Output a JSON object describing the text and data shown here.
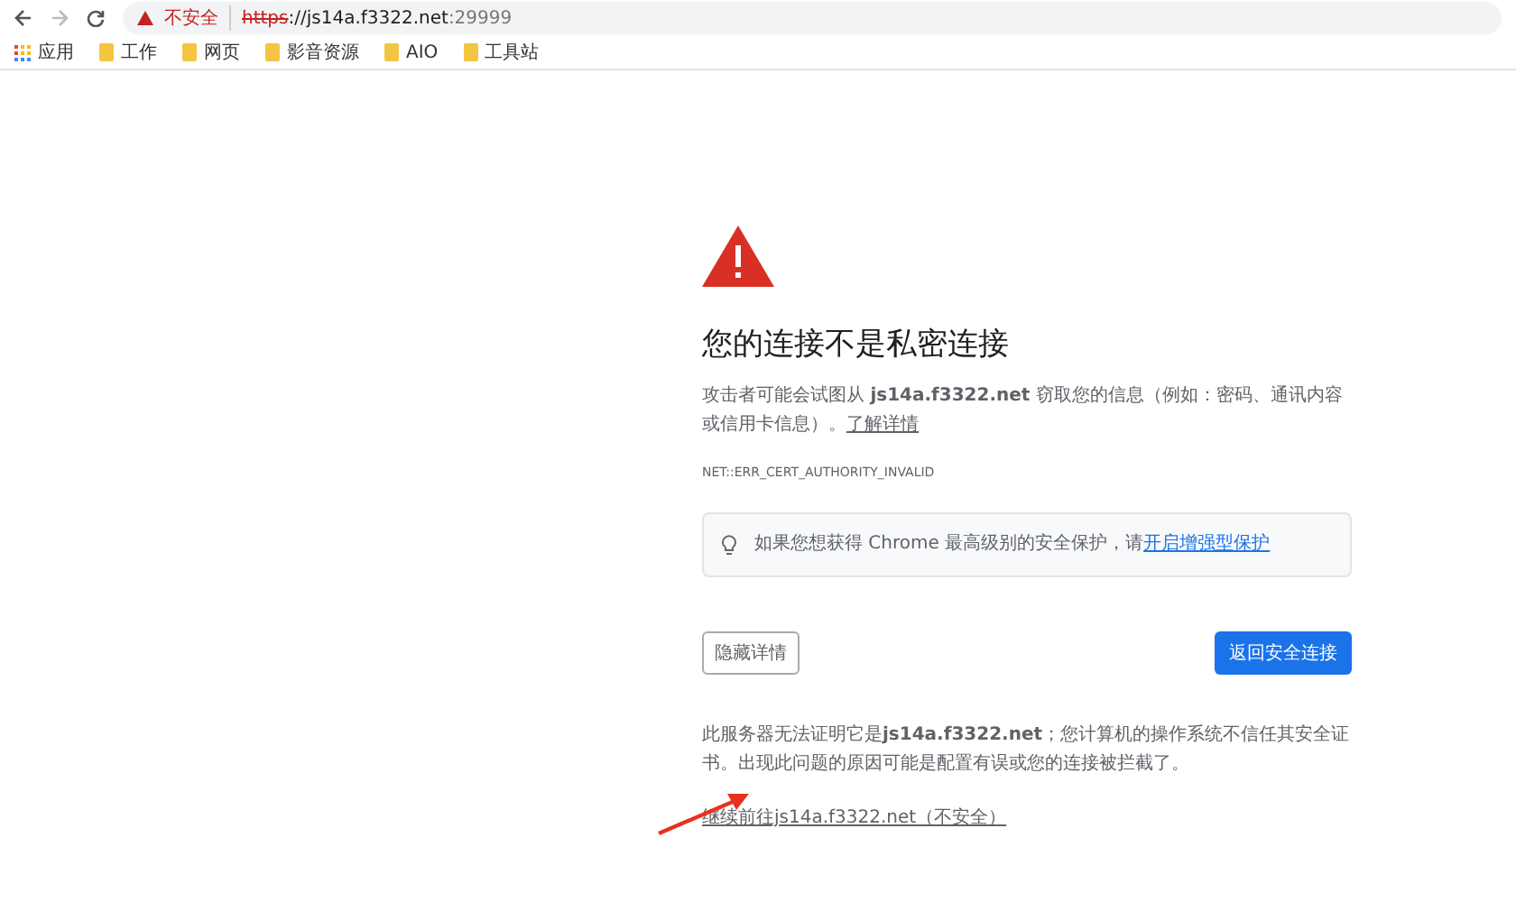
{
  "address_bar": {
    "security_label": "不安全",
    "url_scheme": "https",
    "url_host": "://js14a.f3322.net",
    "url_port": ":29999"
  },
  "bookmarks": [
    {
      "kind": "apps",
      "label": "应用"
    },
    {
      "kind": "folder",
      "label": "工作"
    },
    {
      "kind": "folder",
      "label": "网页"
    },
    {
      "kind": "folder",
      "label": "影音资源"
    },
    {
      "kind": "folder",
      "label": "AIO"
    },
    {
      "kind": "folder",
      "label": "工具站"
    }
  ],
  "error_page": {
    "title": "您的连接不是私密连接",
    "description": "攻击者可能会试图从 **js14a.f3322.net** 窃取您的信息（例如：密码、通讯内容或信用卡信息）。",
    "learn_more": "了解详情",
    "error_code": "NET::ERR_CERT_AUTHORITY_INVALID",
    "tip": {
      "text": "如果您想获得 Chrome 最高级别的安全保护，请",
      "link": "开启增强型保护"
    },
    "hide_details_button": "隐藏详情",
    "back_button": "返回安全连接",
    "details": "此服务器无法证明它是**js14a.f3322.net**；您计算机的操作系统不信任其安全证书。出现此问题的原因可能是配置有误或您的连接被拦截了。",
    "proceed_link": "继续前往js14a.f3322.net（不安全）"
  },
  "annotation": {
    "kind": "arrow"
  }
}
